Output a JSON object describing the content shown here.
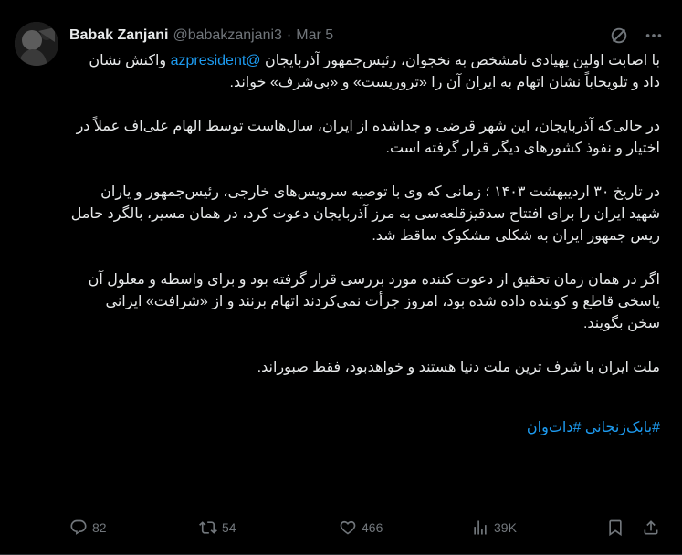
{
  "author": {
    "name": "Babak Zanjani",
    "handle": "@babakzanjani3",
    "separator": "·",
    "date": "Mar 5"
  },
  "tweet": {
    "p1_mention": "@azpresident",
    "p1_text_a": " با اصابت اولین پهپادی نامشخص به نخجوان، رئیس‌جمهور آذربایجان ",
    "p1_text_b": " واکنش نشان داد و تلویحاباً نشان اتهام به ایران آن را «تروریست» و «بی‌شرف» خواند.",
    "p2": "در حالی‌که آذربایجان، این شهر قرضی و جداشده از ایران، سال‌هاست توسط الهام علی‌اف عملاً در اختیار و نفوذ کشورهای دیگر قرار گرفته است.",
    "p3": "در تاریخ ۳۰ اردیبهشت ۱۴۰۳ ؛ زمانی که وی با توصیه سرویس‌های خارجی، رئیس‌جمهور و یاران شهید ایران را برای افتتاح سدقیزقلعه‌سی به مرز آذربایجان دعوت کرد، در همان مسیر، بالگرد حامل ریس جمهور ایران به شکلی مشکوک ساقط شد.",
    "p4": "اگر در همان زمان تحقیق از دعوت کننده مورد  بررسی قرار گرفته بود و برای واسطه و معلول آن  پاسخی قاطع و کوبنده داده شده بود، امروز جرأت نمی‌کردند اتهام برنند و از «شرافت» ایرانی سخن بگویند.",
    "p5": "ملت ایران با شرف ترین ملت دنیا هستند و خواهدبود، فقط صبوراند.",
    "hashtags": "#بابک‌زنجانی #دات‌وان"
  },
  "metrics": {
    "replies": "82",
    "retweets": "54",
    "likes": "466",
    "views": "39K"
  },
  "colors": {
    "background": "#000000",
    "text": "#e7e9ea",
    "muted": "#71767b",
    "link": "#1d9bf0"
  },
  "icons": {
    "reply": "speech-bubble-icon",
    "retweet": "retweet-icon",
    "like": "heart-icon",
    "views": "bar-chart-icon",
    "bookmark": "bookmark-icon",
    "share": "share-icon",
    "grok": "grok-icon",
    "more": "more-dots-icon"
  }
}
